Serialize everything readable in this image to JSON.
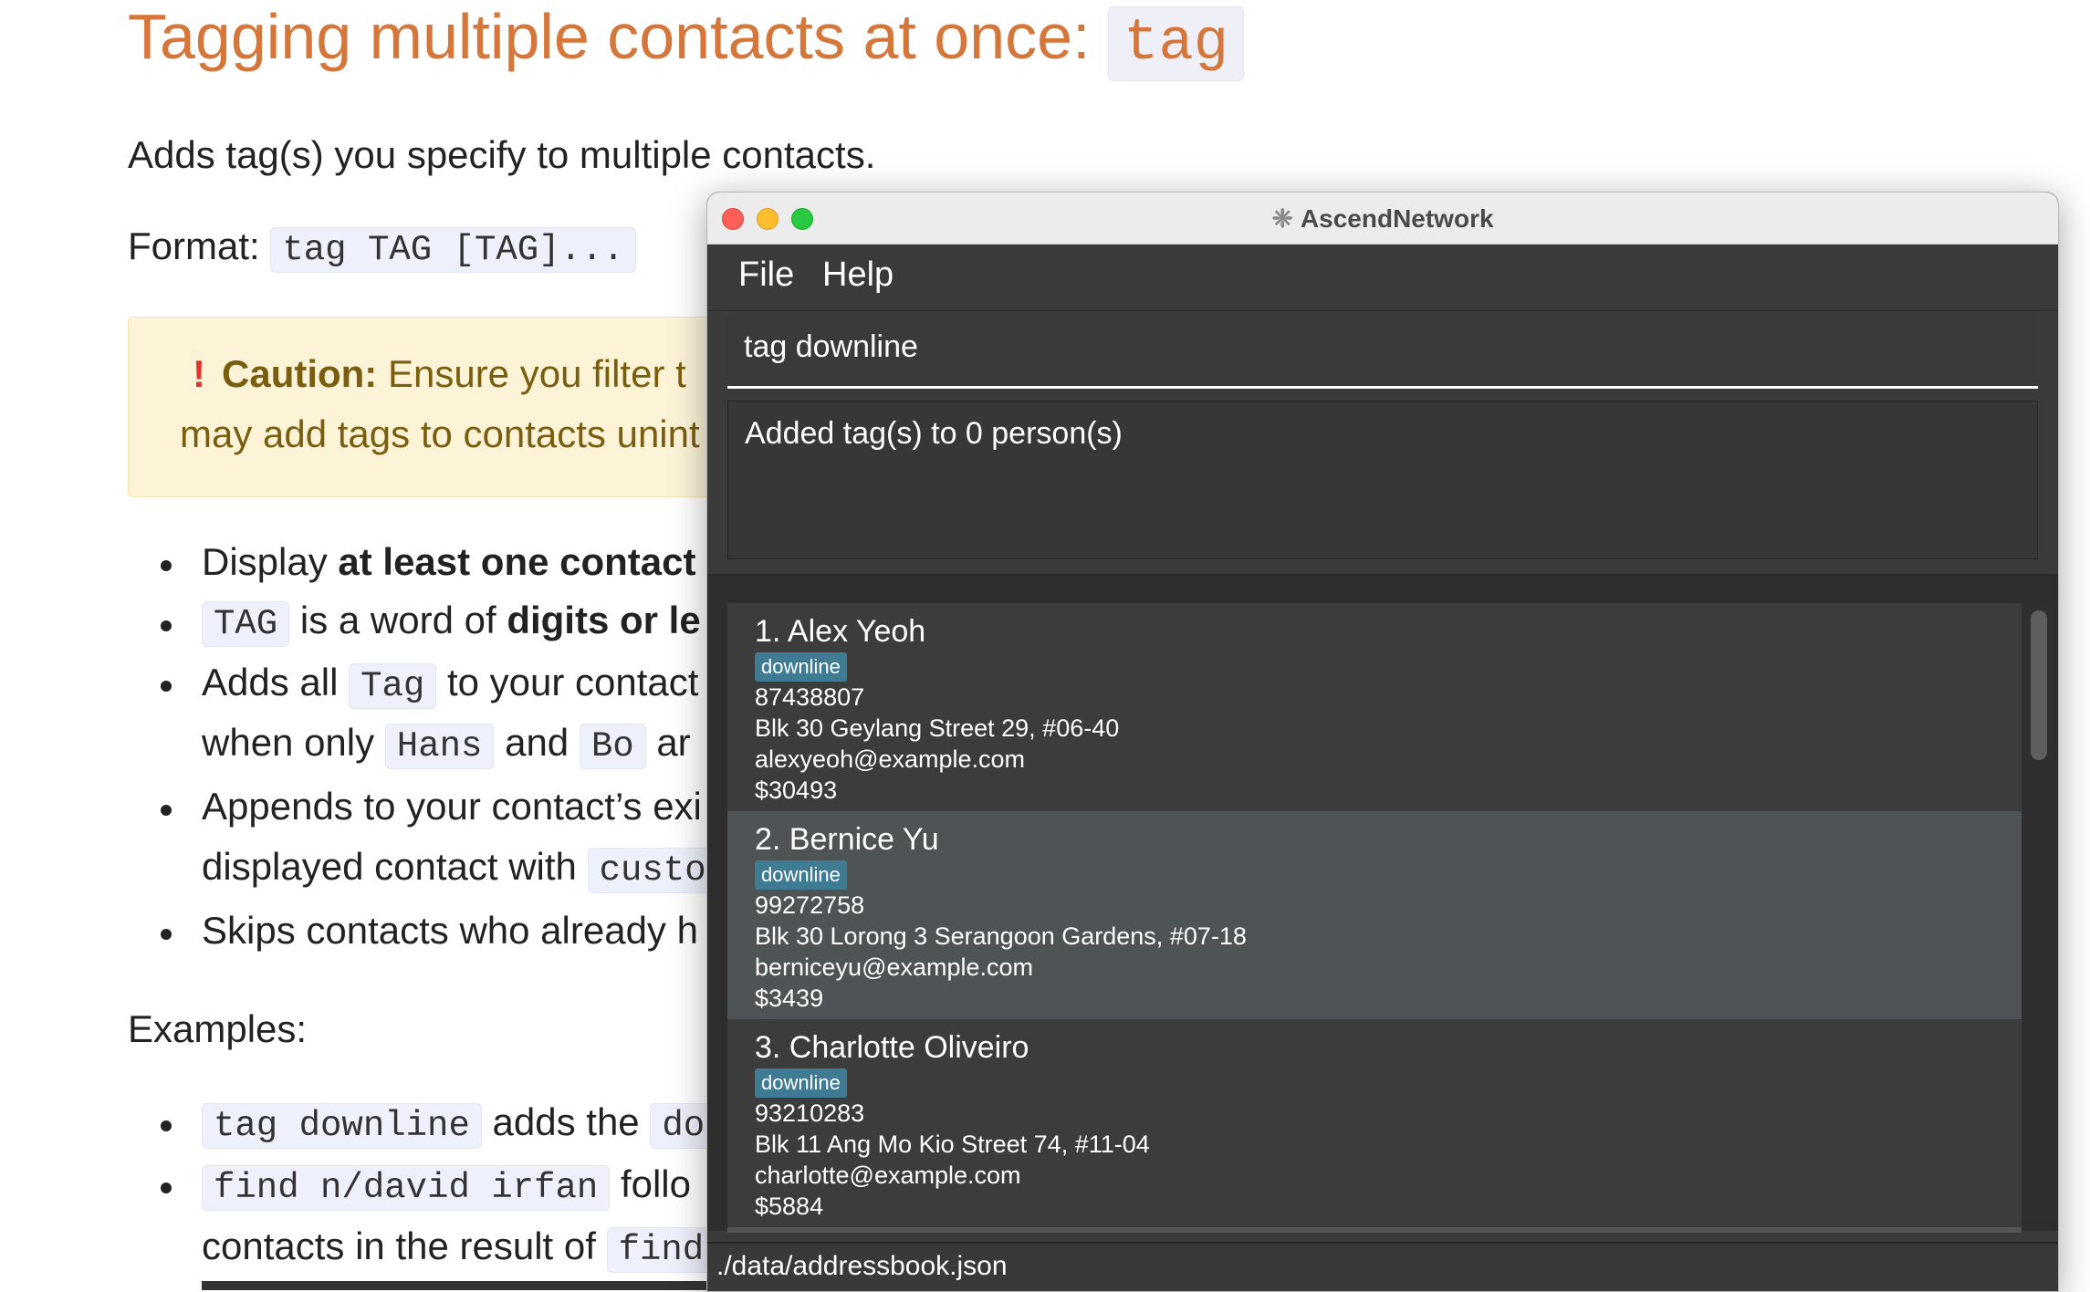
{
  "docs": {
    "title": "Tagging multiple contacts at once:",
    "title_code": "tag",
    "intro": "Adds tag(s) you specify to multiple contacts.",
    "format_label": "Format:",
    "format_code": "tag TAG [TAG]...",
    "caution": {
      "label": "Caution:",
      "line1": "Ensure you filter t",
      "line2": "may add tags to contacts unint"
    },
    "bullets": [
      {
        "a": "Display ",
        "b": "at least one contact"
      },
      {
        "code": "TAG",
        "a": " is a word of ",
        "b": "digits or le"
      },
      {
        "a": "Adds all ",
        "code": "Tag",
        "c": " to your contact"
      },
      {
        "a": "when only ",
        "code1": "Hans",
        "b": " and ",
        "code2": "Bo",
        "c": " ar"
      },
      {
        "a": "Appends to your contact’s exi"
      },
      {
        "a": "displayed contact with ",
        "code": "custo"
      },
      {
        "a": "Skips contacts who already h"
      }
    ],
    "examples_label": "Examples:",
    "examples": [
      {
        "code": "tag downline",
        "a": " adds the ",
        "code2": "do"
      },
      {
        "code": "find n/david irfan",
        "a": " follo"
      },
      {
        "a": "contacts in the result of ",
        "code": "find"
      }
    ]
  },
  "app": {
    "window_title": "AscendNetwork",
    "menu": [
      "File",
      "Help"
    ],
    "command_value": "tag downline",
    "result": "Added tag(s) to 0 person(s)",
    "contacts": [
      {
        "name": "1. Alex Yeoh",
        "tag": "downline",
        "phone": "87438807",
        "address": "Blk 30 Geylang Street 29, #06-40",
        "email": "alexyeoh@example.com",
        "amount": "$30493"
      },
      {
        "name": "2. Bernice Yu",
        "tag": "downline",
        "phone": "99272758",
        "address": "Blk 30 Lorong 3 Serangoon Gardens, #07-18",
        "email": "berniceyu@example.com",
        "amount": "$3439"
      },
      {
        "name": "3. Charlotte Oliveiro",
        "tag": "downline",
        "phone": "93210283",
        "address": "Blk 11 Ang Mo Kio Street 74, #11-04",
        "email": "charlotte@example.com",
        "amount": "$5884"
      }
    ],
    "selected_index": 1,
    "status_path": "./data/addressbook.json",
    "colors": {
      "tag_bg": "#3f7c93",
      "selected_row": "#4e5456",
      "heading": "#d5773a"
    }
  }
}
